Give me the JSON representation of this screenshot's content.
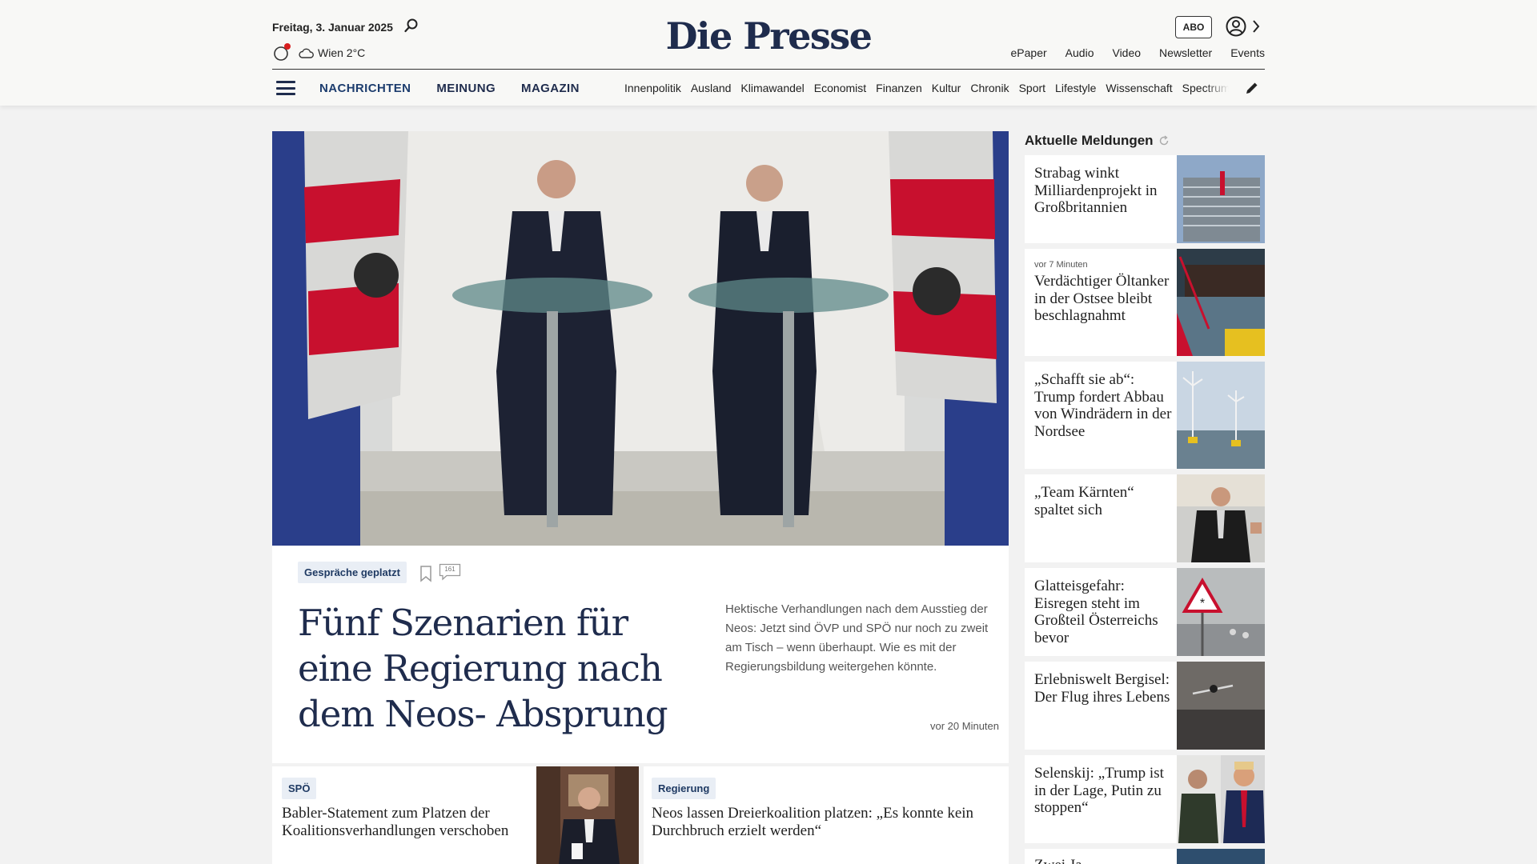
{
  "header": {
    "date": "Freitag, 3. Januar 2025",
    "weather": "Wien 2°C",
    "logo": "Die Presse",
    "abo": "ABO",
    "links": [
      "ePaper",
      "Audio",
      "Video",
      "Newsletter",
      "Events"
    ]
  },
  "nav": {
    "main": [
      "NACHRICHTEN",
      "MEINUNG",
      "MAGAZIN"
    ],
    "sub": [
      "Innenpolitik",
      "Ausland",
      "Klimawandel",
      "Economist",
      "Finanzen",
      "Kultur",
      "Chronik",
      "Sport",
      "Lifestyle",
      "Wissenschaft",
      "Spectrum"
    ]
  },
  "hero": {
    "tag": "Gespräche geplatzt",
    "comments": "161",
    "title": "Fünf Szenarien für eine Regierung nach dem Neos- Absprung",
    "teaser": "Hektische Verhandlungen nach dem Ausstieg der Neos: Jetzt sind ÖVP und SPÖ nur noch zu zweit am Tisch – wenn überhaupt. Wie es mit der Regierungsbildung weitergehen könnte.",
    "time": "vor 20 Minuten"
  },
  "sub_articles": [
    {
      "tag": "SPÖ",
      "title": "Babler-Statement zum Platzen der Koalitionsverhandlungen verschoben"
    },
    {
      "tag": "Regierung",
      "title": "Neos lassen Dreierkoalition platzen: „Es konnte kein Durchbruch erzielt werden“"
    }
  ],
  "sidebar": {
    "heading": "Aktuelle Meldungen",
    "items": [
      {
        "meta": "",
        "title": "Strabag winkt Milliardenprojekt in Großbritannien"
      },
      {
        "meta": "vor 7 Minuten",
        "title": "Verdächtiger Öltanker in der Ostsee bleibt beschlagnahmt"
      },
      {
        "meta": "",
        "title": "„Schafft sie ab“: Trump fordert Abbau von Windrädern in der Nordsee"
      },
      {
        "meta": "",
        "title": "„Team Kärnten“ spaltet sich"
      },
      {
        "meta": "",
        "title": "Glatteisgefahr: Eisregen steht im Großteil Österreichs bevor"
      },
      {
        "meta": "",
        "title": "Erlebniswelt Bergisel: Der Flug ihres Lebens"
      },
      {
        "meta": "",
        "title": "Selenskij: „Trump ist in der Lage, Putin zu stoppen“"
      },
      {
        "meta": "",
        "title": "Zwei Ja..."
      }
    ]
  },
  "colors": {
    "brand": "#1f2c4d",
    "tag_bg": "#e9eef5",
    "alert": "#d81e1e"
  }
}
